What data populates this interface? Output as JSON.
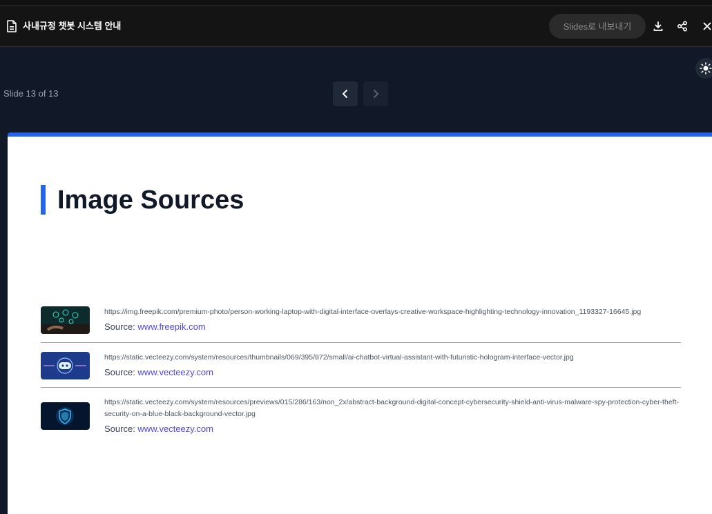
{
  "header": {
    "doc_title": "사내규정 챗봇 시스템 안내",
    "export_label": "Slides로 내보내기",
    "icons": [
      "document-icon",
      "download-icon",
      "share-icon",
      "close-icon"
    ]
  },
  "viewer": {
    "slide_counter": "Slide 13 of 13",
    "icons": [
      "chevron-left-icon",
      "chevron-right-icon",
      "sun-icon"
    ]
  },
  "slide": {
    "title": "Image Sources",
    "accent_color": "#2563eb",
    "sources": [
      {
        "url": "https://img.freepik.com/premium-photo/person-working-laptop-with-digital-interface-overlays-creative-workspace-highlighting-technology-innovation_1193327-16645.jpg",
        "source_label": "Source: ",
        "source_link": "www.freepik.com"
      },
      {
        "url": "https://static.vecteezy.com/system/resources/thumbnails/069/395/872/small/ai-chatbot-virtual-assistant-with-futuristic-hologram-interface-vector.jpg",
        "source_label": "Source: ",
        "source_link": "www.vecteezy.com"
      },
      {
        "url": "https://static.vecteezy.com/system/resources/previews/015/286/163/non_2x/abstract-background-digital-concept-cybersecurity-shield-anti-virus-malware-spy-protection-cyber-theft-security-on-a-blue-black-background-vector.jpg",
        "source_label": "Source: ",
        "source_link": "www.vecteezy.com"
      }
    ]
  }
}
